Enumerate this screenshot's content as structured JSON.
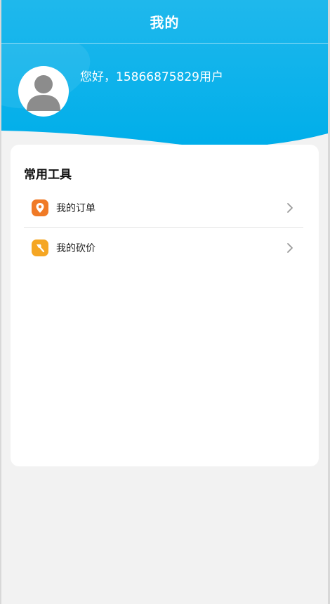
{
  "header": {
    "title": "我的"
  },
  "user": {
    "greeting": "您好，15866875829用户",
    "avatar_icon": "person-avatar-icon"
  },
  "tools": {
    "title": "常用工具",
    "items": [
      {
        "label": "我的订单",
        "icon": "location-pin-icon",
        "icon_color": "#f07a26"
      },
      {
        "label": "我的砍价",
        "icon": "axe-icon",
        "icon_color": "#f5a623"
      }
    ]
  },
  "colors": {
    "brand_blue": "#12aee6",
    "page_bg": "#f2f2f2"
  }
}
